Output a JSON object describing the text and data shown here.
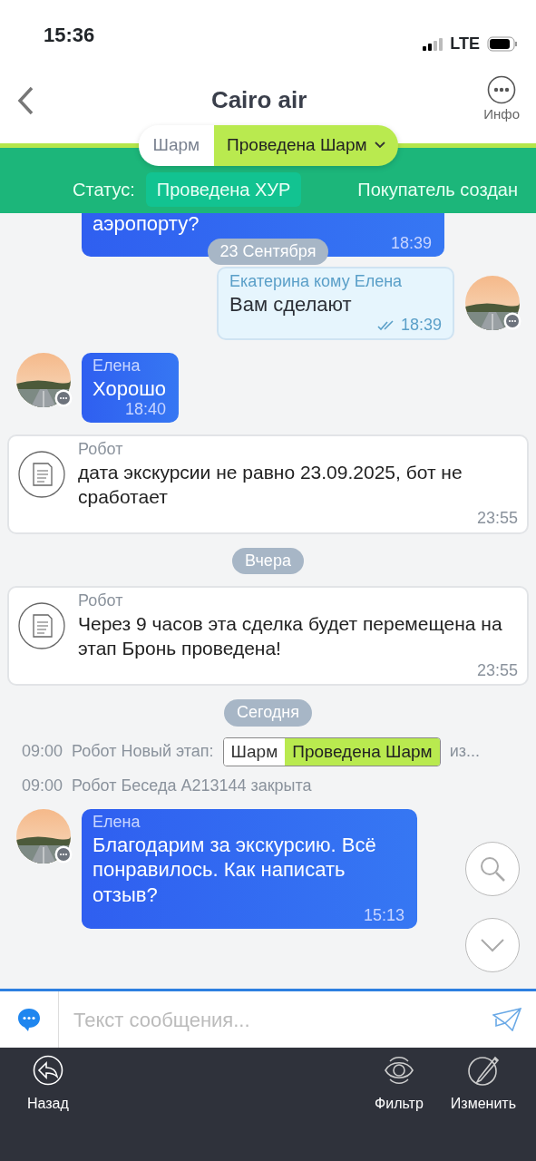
{
  "status_bar": {
    "time": "15:36",
    "network": "LTE"
  },
  "header": {
    "title": "Cairo air",
    "info_label": "Инфо"
  },
  "stage": {
    "previous": "Шарм",
    "current": "Проведена Шарм"
  },
  "deal": {
    "status_label": "Статус:",
    "status": "Проведена ХУР",
    "buyer": "Покупатель создан"
  },
  "messages": [
    {
      "kind": "incoming",
      "avatar": false,
      "text": "аэропорту?",
      "time": "18:39"
    },
    {
      "kind": "date",
      "text": "23 Сентября"
    },
    {
      "kind": "outgoing",
      "sender": "Екатерина кому Елена",
      "text": "Вам сделают",
      "time": "18:39",
      "read": true
    },
    {
      "kind": "incoming",
      "avatar": true,
      "sender": "Елена",
      "text": "Хорошо",
      "time": "18:40"
    },
    {
      "kind": "robot",
      "sender": "Робот",
      "text": "дата экскурсии не равно 23.09.2025, бот не сработает",
      "time": "23:55"
    },
    {
      "kind": "date",
      "text": "Вчера"
    },
    {
      "kind": "robot",
      "sender": "Робот",
      "text": "Через 9 часов эта сделка будет перемещена на этап Бронь проведена!",
      "time": "23:55"
    },
    {
      "kind": "date",
      "text": "Сегодня"
    },
    {
      "kind": "event",
      "time": "09:00",
      "text": "Робот Новый этап:",
      "stage_from": "Шарм",
      "stage_to": "Проведена Шарм",
      "tail": "из..."
    },
    {
      "kind": "event",
      "time": "09:00",
      "text": "Робот Беседа А213144 закрыта"
    },
    {
      "kind": "incoming",
      "avatar": true,
      "sender": "Елена",
      "text": "Благодарим за экскурсию. Всё понравилось. Как написать отзыв?",
      "time": "15:13"
    }
  ],
  "composer": {
    "placeholder": "Текст сообщения..."
  },
  "toolbar": [
    {
      "label": "Назад"
    },
    {
      "label": "Фильтр"
    },
    {
      "label": "Изменить"
    }
  ]
}
